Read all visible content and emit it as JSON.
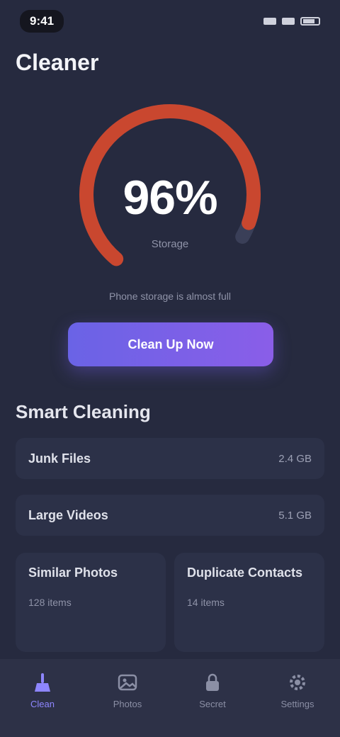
{
  "status_bar": {
    "time": "9:41"
  },
  "page": {
    "title": "Cleaner"
  },
  "gauge": {
    "value": "96%",
    "fill_fraction": 0.96,
    "subtitle": "Storage",
    "caption": "Phone storage is almost full",
    "color": "#c9472f",
    "track_color": "#3a3f58"
  },
  "primary_action": {
    "label": "Clean Up Now"
  },
  "section": {
    "title": "Smart Cleaning"
  },
  "features": [
    {
      "label": "Junk Files",
      "value": "2.4 GB"
    },
    {
      "label": "Large Videos",
      "value": "5.1 GB"
    }
  ],
  "cards": [
    {
      "title": "Similar Photos",
      "meta": "128 items"
    },
    {
      "title": "Duplicate Contacts",
      "meta": "14 items"
    }
  ],
  "tabs": [
    {
      "label": "Clean",
      "icon": "broom-icon",
      "active": true
    },
    {
      "label": "Photos",
      "icon": "photo-icon",
      "active": false
    },
    {
      "label": "Secret",
      "icon": "lock-icon",
      "active": false
    },
    {
      "label": "Settings",
      "icon": "gear-icon",
      "active": false
    }
  ],
  "colors": {
    "background": "#262a3f",
    "accent": "#7a60e8",
    "gauge": "#c9472f"
  }
}
